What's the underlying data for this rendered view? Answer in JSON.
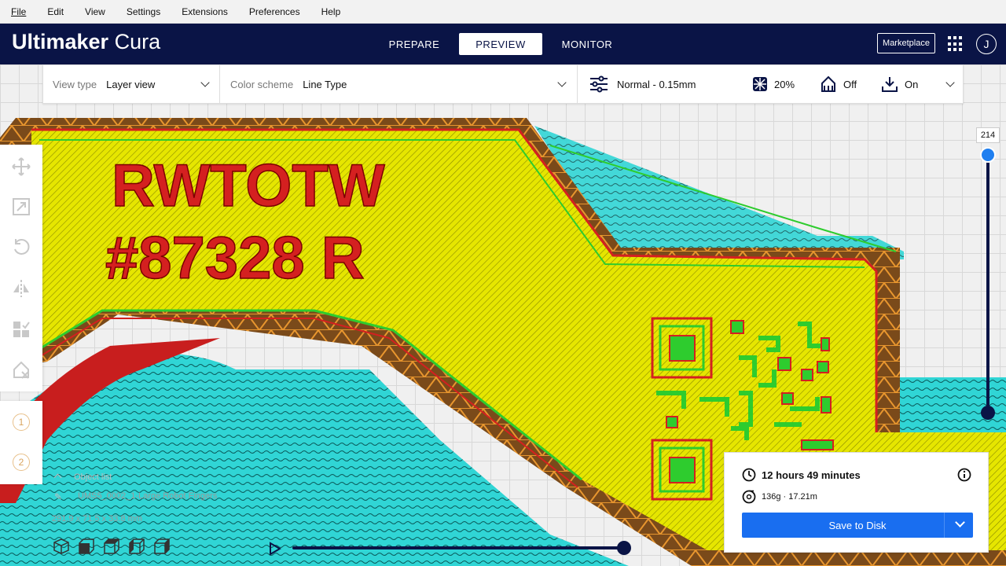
{
  "menu": [
    "File",
    "Edit",
    "View",
    "Settings",
    "Extensions",
    "Preferences",
    "Help"
  ],
  "header": {
    "brand_bold": "Ultimaker",
    "brand_light": "Cura",
    "stages": [
      "PREPARE",
      "PREVIEW",
      "MONITOR"
    ],
    "active_stage": "PREVIEW",
    "marketplace": "Marketplace",
    "avatar_initial": "J"
  },
  "toolbar": {
    "view_type_label": "View type",
    "view_type_value": "Layer view",
    "color_scheme_label": "Color scheme",
    "color_scheme_value": "Line Type",
    "profile": "Normal - 0.15mm",
    "infill": "20%",
    "support": "Off",
    "adhesion": "On"
  },
  "viewport": {
    "model_text_line1": "RWTOTW",
    "model_text_line2": "#87328 R"
  },
  "object": {
    "list_label": "Object list",
    "name": "UMS5_0002_1-Large Robot Fingers",
    "dimensions": "291.9 x 71.5 x 33.8 mm"
  },
  "extruders": [
    "1",
    "2"
  ],
  "layer_slider": {
    "current_layer": "214"
  },
  "print_info": {
    "time": "12 hours 49 minutes",
    "material": "136g · 17.21m",
    "save_button": "Save to Disk"
  },
  "colors": {
    "header_bg": "#0a1446",
    "accent_blue": "#196ef0",
    "skin_yellow": "#e6e600",
    "wall_red": "#d42020",
    "inner_wall_green": "#2ecc2e",
    "support_cyan": "#30d5d5",
    "infill_orange": "#e8962e"
  }
}
